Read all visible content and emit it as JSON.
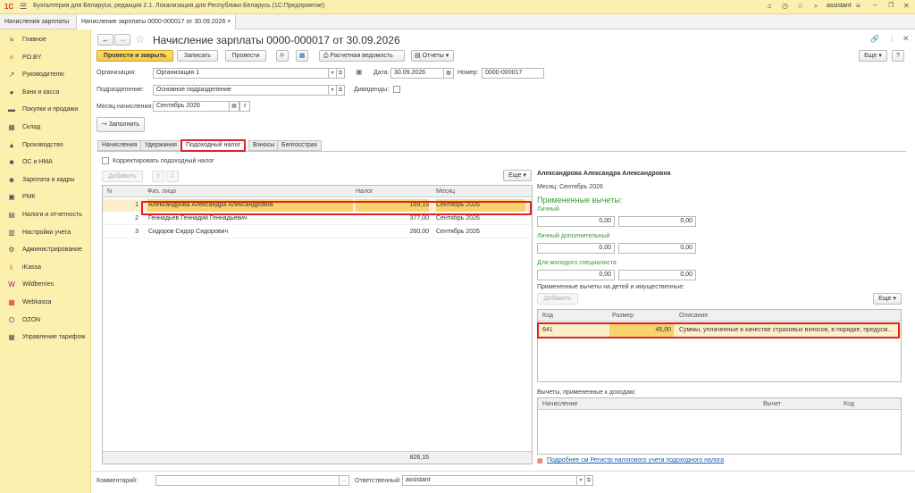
{
  "app": {
    "title": "Бухгалтерия для Беларуси, редакция 2.1. Локализация для Республики Беларусь  (1С:Предприятие)",
    "user": "assistant"
  },
  "open_tabs": [
    {
      "label": "Начисления зарплаты"
    },
    {
      "label": "Начисление зарплаты 0000-000017 от 30.09.2026 ×"
    }
  ],
  "sidebar": {
    "items": [
      {
        "label": "Главное",
        "icon": "≡",
        "color": "#555"
      },
      {
        "label": "PO.BY",
        "icon": "✳",
        "color": "#e6892c"
      },
      {
        "label": "Руководителю",
        "icon": "↗",
        "color": "#555"
      },
      {
        "label": "Банк и касса",
        "icon": "●",
        "color": "#555"
      },
      {
        "label": "Покупки и продажи",
        "icon": "▬",
        "color": "#555"
      },
      {
        "label": "Склад",
        "icon": "▦",
        "color": "#555"
      },
      {
        "label": "Производство",
        "icon": "▲",
        "color": "#555"
      },
      {
        "label": "ОС и НМА",
        "icon": "■",
        "color": "#555"
      },
      {
        "label": "Зарплата и кадры",
        "icon": "☻",
        "color": "#555"
      },
      {
        "label": "РМК",
        "icon": "▣",
        "color": "#555"
      },
      {
        "label": "Налоги и отчетность",
        "icon": "▤",
        "color": "#555"
      },
      {
        "label": "Настройки учета",
        "icon": "▥",
        "color": "#555"
      },
      {
        "label": "Администрирование",
        "icon": "⚙",
        "color": "#555"
      },
      {
        "label": "iKassa",
        "icon": "k",
        "color": "#e6892c"
      },
      {
        "label": "Wildberries",
        "icon": "W",
        "color": "#8b1c8f"
      },
      {
        "label": "Webkassa",
        "icon": "▦",
        "color": "#d9342b"
      },
      {
        "label": "OZON",
        "icon": "O",
        "color": "#1b5fd6"
      },
      {
        "label": "Управление тарифом",
        "icon": "▦",
        "color": "#555"
      }
    ]
  },
  "doc": {
    "title": "Начисление зарплаты 0000-000017 от 30.09.2026",
    "toolbar": {
      "post_close": "Провести и закрыть",
      "save": "Записать",
      "post": "Провести",
      "payroll": "Расчетная ведомость",
      "reports": "Отчеты ▾",
      "more": "Еще ▾",
      "help": "?"
    },
    "fields": {
      "org_label": "Организация:",
      "org_value": "Организация 1",
      "date_label": "Дата:",
      "date_value": "30.09.2026",
      "number_label": "Номер:",
      "number_value": "0000-000017",
      "dept_label": "Подразделение:",
      "dept_value": "Основное подразделение",
      "dividends_label": "Дивиденды:",
      "month_label": "Месяц начисления:",
      "month_value": "Сентябрь 2026",
      "fill_button": "Заполнить"
    },
    "tabs": [
      "Начисления",
      "Удержания",
      "Подоходный налог",
      "Взносы",
      "Белгосстрах"
    ],
    "active_tab": 2
  },
  "left": {
    "correct_label": "Корректировать подоходный налог",
    "add_button": "Добавить",
    "more": "Еще ▾",
    "columns": [
      "N",
      "Физ. лицо",
      "Налог",
      "Месяц"
    ],
    "rows": [
      {
        "n": "1",
        "name": "Александрова Александра Александровна",
        "tax": "189,15",
        "month": "Сентябрь 2026"
      },
      {
        "n": "2",
        "name": "Геннадьев Геннадий Геннадьевич",
        "tax": "377,00",
        "month": "Сентябрь 2026"
      },
      {
        "n": "3",
        "name": "Сидоров Сидор Сидорович",
        "tax": "260,00",
        "month": "Сентябрь 2026"
      }
    ],
    "total": "826,15"
  },
  "right": {
    "person": "Александрова Александра Александровна",
    "month": "Месяц: Сентябрь 2026",
    "applied_title": "Примененные вычеты:",
    "groups": [
      {
        "label": "Личный",
        "v1": "0,00",
        "v2": "0,00"
      },
      {
        "label": "Личный дополнительный",
        "v1": "0,00",
        "v2": "0,00"
      },
      {
        "label": "Для молодого специалиста",
        "v1": "0,00",
        "v2": "0,00"
      }
    ],
    "children_label": "Примененные вычеты на детей и имущественные:",
    "add_button": "Добавить",
    "more": "Еще ▾",
    "ded_columns": [
      "Код",
      "Размер",
      "Описание"
    ],
    "ded_rows": [
      {
        "code": "641",
        "size": "45,00",
        "desc": "Суммы, уплаченные в качестве страховых взносов, в порядке, предусм..."
      }
    ],
    "income_label": "Вычеты, примененные к доходам:",
    "inc_columns": [
      "Начисление",
      "Вычет",
      "Код"
    ],
    "register_link": "Подробнее см Регистр налогового учета подоходного налога"
  },
  "footer": {
    "comment_label": "Комментарий:",
    "responsible_label": "Ответственный:",
    "responsible_value": "assistant"
  }
}
